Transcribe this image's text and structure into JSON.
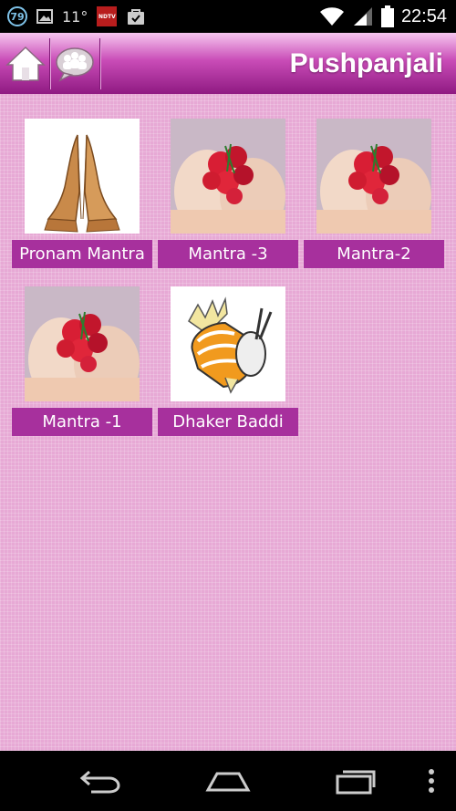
{
  "status_bar": {
    "notification_count": "79",
    "temperature": "11°",
    "news_badge": "NDTV",
    "time": "22:54"
  },
  "action_bar": {
    "title": "Pushpanjali",
    "home_icon": "home-icon",
    "people_icon": "people-chat-icon"
  },
  "items": [
    {
      "label": "Pronam Mantra",
      "image": "praying-hands"
    },
    {
      "label": "Mantra -3",
      "image": "flower-offering"
    },
    {
      "label": "Mantra-2",
      "image": "flower-offering"
    },
    {
      "label": "Mantra -1",
      "image": "flower-offering"
    },
    {
      "label": "Dhaker Baddi",
      "image": "dhak-drum"
    }
  ],
  "nav": {
    "back_icon": "back-icon",
    "home_icon": "home-icon",
    "recents_icon": "recents-icon",
    "menu_icon": "overflow-menu-icon"
  }
}
